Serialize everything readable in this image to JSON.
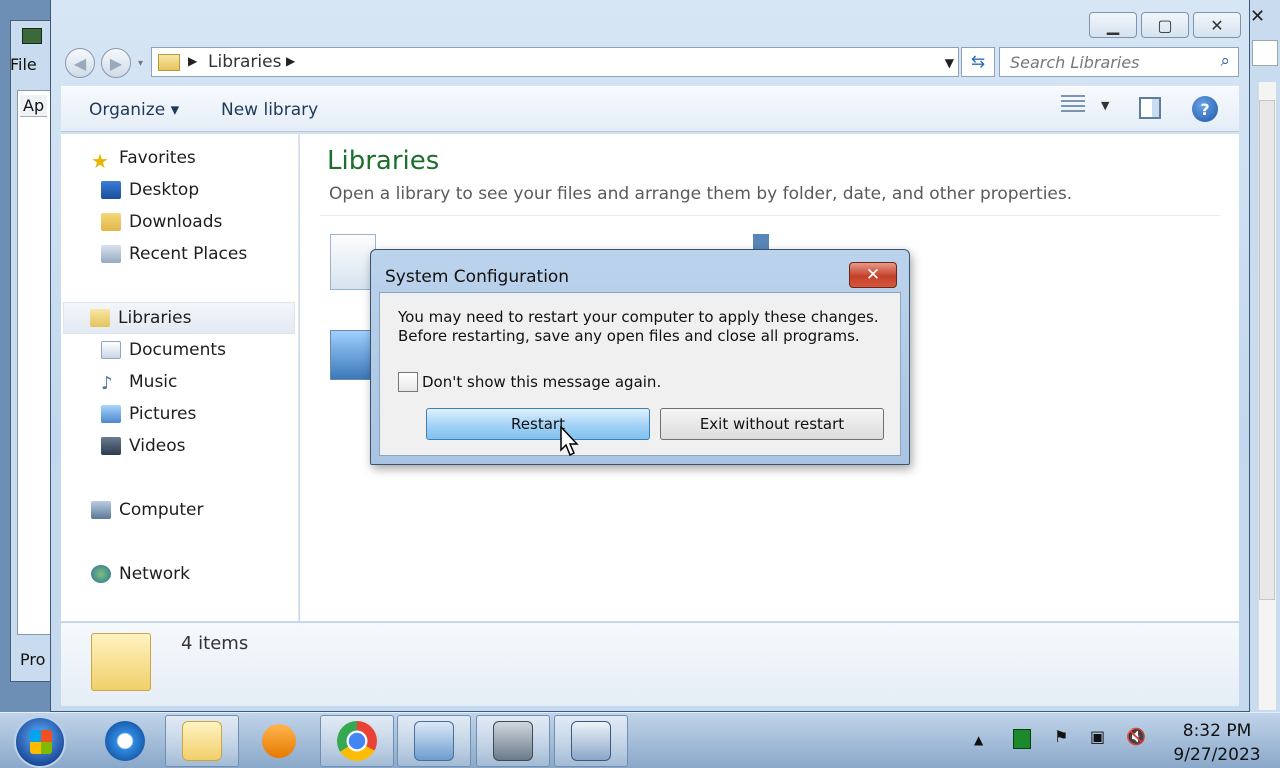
{
  "background_window": {
    "menu_label": "File",
    "tab_label": "Ap",
    "footer_label": "Pro"
  },
  "explorer": {
    "address": {
      "crumb": "Libraries"
    },
    "search": {
      "placeholder": "Search Libraries"
    },
    "toolbar": {
      "organize": "Organize ▾",
      "new_library": "New library",
      "help": "?"
    },
    "nav": {
      "favorites": "Favorites",
      "desktop": "Desktop",
      "downloads": "Downloads",
      "recent_places": "Recent Places",
      "libraries": "Libraries",
      "documents": "Documents",
      "music": "Music",
      "pictures": "Pictures",
      "videos": "Videos",
      "computer": "Computer",
      "network": "Network"
    },
    "content": {
      "title": "Libraries",
      "description": "Open a library to see your files and arrange them by folder, date, and other properties."
    },
    "details": {
      "count": "4 items"
    }
  },
  "dialog": {
    "title": "System Configuration",
    "close": "✕",
    "message_line1": "You may need to restart your computer to apply these changes.",
    "message_line2": "Before restarting, save any open files and close all programs.",
    "checkbox_label": "Don't show this message again.",
    "restart": "Restart",
    "exit_without_restart": "Exit without restart"
  },
  "taskbar": {
    "apps": [
      "internet-explorer",
      "windows-explorer",
      "media-player",
      "chrome",
      "control-panel",
      "performance-monitor",
      "system-configuration"
    ],
    "clock": {
      "time": "8:32 PM",
      "date": "9/27/2023"
    }
  }
}
